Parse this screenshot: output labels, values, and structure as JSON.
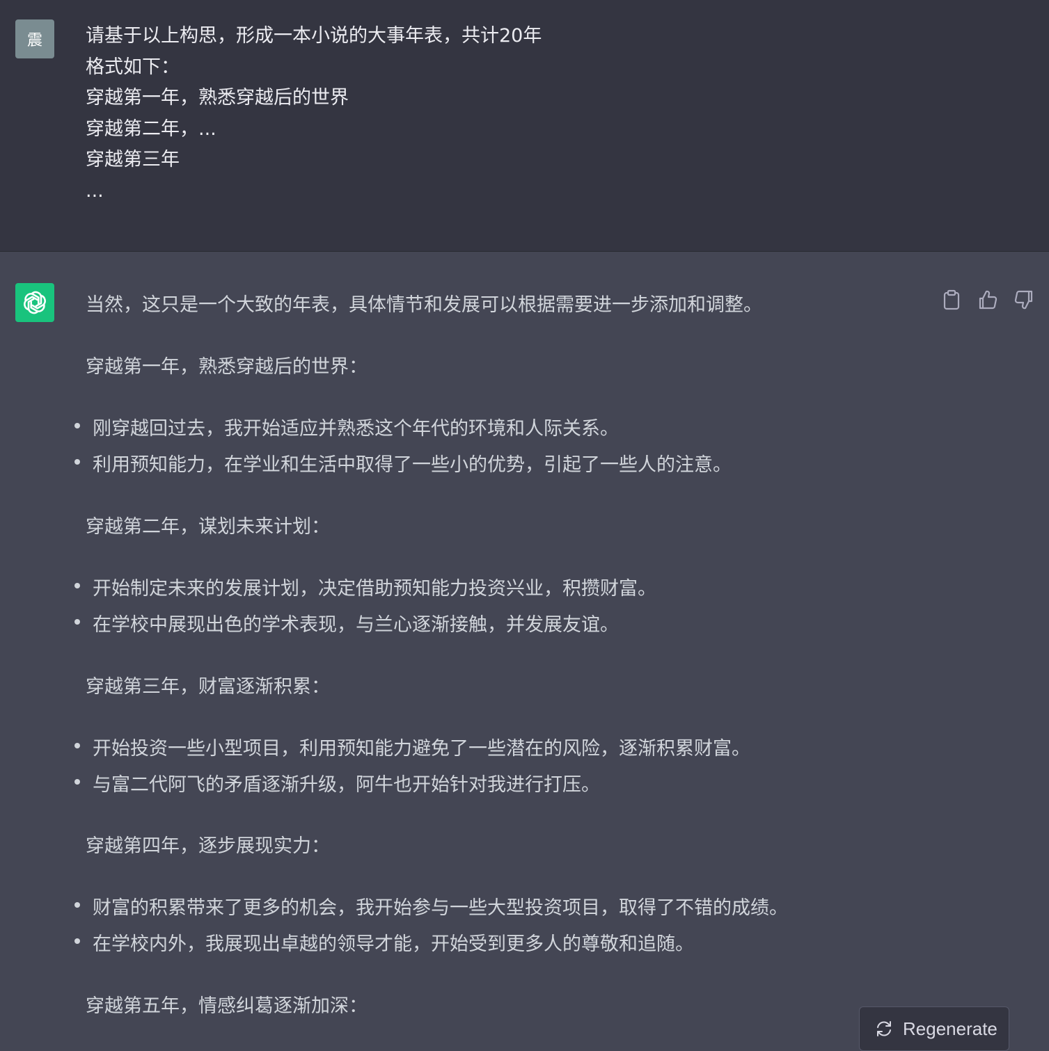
{
  "user": {
    "avatar_text": "震",
    "lines": [
      "请基于以上构思，形成一本小说的大事年表，共计20年",
      "格式如下：",
      "穿越第一年，熟悉穿越后的世界",
      "穿越第二年，...",
      "穿越第三年",
      "..."
    ]
  },
  "assistant": {
    "intro": "当然，这只是一个大致的年表，具体情节和发展可以根据需要进一步添加和调整。",
    "sections": [
      {
        "heading": "穿越第一年，熟悉穿越后的世界：",
        "items": [
          "刚穿越回过去，我开始适应并熟悉这个年代的环境和人际关系。",
          "利用预知能力，在学业和生活中取得了一些小的优势，引起了一些人的注意。"
        ]
      },
      {
        "heading": "穿越第二年，谋划未来计划：",
        "items": [
          "开始制定未来的发展计划，决定借助预知能力投资兴业，积攒财富。",
          "在学校中展现出色的学术表现，与兰心逐渐接触，并发展友谊。"
        ]
      },
      {
        "heading": "穿越第三年，财富逐渐积累：",
        "items": [
          "开始投资一些小型项目，利用预知能力避免了一些潜在的风险，逐渐积累财富。",
          "与富二代阿飞的矛盾逐渐升级，阿牛也开始针对我进行打压。"
        ]
      },
      {
        "heading": "穿越第四年，逐步展现实力：",
        "items": [
          "财富的积累带来了更多的机会，我开始参与一些大型投资项目，取得了不错的成绩。",
          "在学校内外，我展现出卓越的领导才能，开始受到更多人的尊敬和追随。"
        ]
      },
      {
        "heading": "穿越第五年，情感纠葛逐渐加深：",
        "items": []
      }
    ]
  },
  "actions": {
    "copy_icon": "clipboard-icon",
    "like_icon": "thumbs-up-icon",
    "dislike_icon": "thumbs-down-icon"
  },
  "regenerate": {
    "label": "Regenerate",
    "icon": "refresh-icon"
  },
  "colors": {
    "user_bg": "#343541",
    "assistant_bg": "#444654",
    "bot_avatar": "#19c37d",
    "user_avatar": "#7a8c91"
  }
}
